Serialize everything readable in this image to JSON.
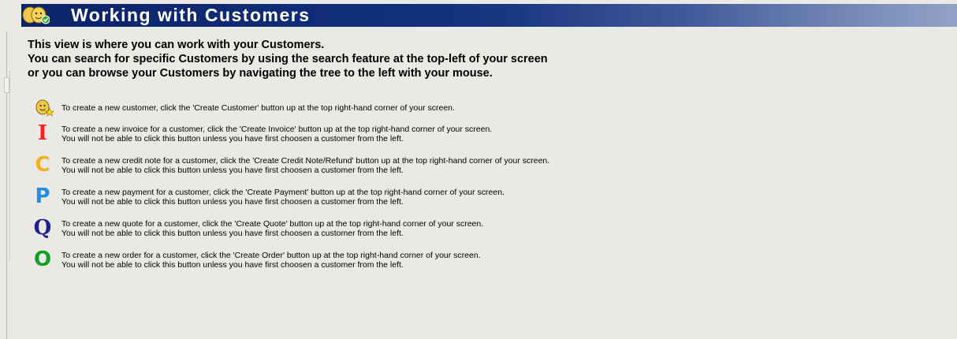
{
  "header": {
    "title": "Working with Customers",
    "icon": "customers-icon"
  },
  "intro": {
    "lines": [
      "This view is where you can work with your Customers.",
      "You can search for specific Customers by using the search feature at the top-left of your screen",
      "or you can browse your Customers by navigating the tree to the left with your mouse."
    ]
  },
  "tips": [
    {
      "icon": "create-customer-icon",
      "glyph": "",
      "color": "#000000",
      "line1": "To create a new customer, click the 'Create Customer' button up at the top right-hand corner of your screen.",
      "line2": ""
    },
    {
      "icon": "invoice-icon",
      "glyph": "I",
      "color": "#ff1e1e",
      "line1": "To create a new invoice for a customer, click the 'Create Invoice' button up at the top right-hand corner of your screen.",
      "line2": "You will not be able to click this button unless you have first choosen a customer from the left."
    },
    {
      "icon": "credit-note-icon",
      "glyph": "C",
      "color": "#f2b21a",
      "line1": "To create a new credit note for a customer, click the 'Create Credit Note/Refund' button up at the top right-hand corner of your screen.",
      "line2": "You will not be able to click this button unless you have first choosen a customer from the left."
    },
    {
      "icon": "payment-icon",
      "glyph": "P",
      "color": "#1e8ee6",
      "line1": "To create a new payment for a customer, click the 'Create Payment' button up at the top right-hand corner of your screen.",
      "line2": "You will not be able to click this button unless you have first choosen a customer from the left."
    },
    {
      "icon": "quote-icon",
      "glyph": "Q",
      "color": "#20208a",
      "line1": "To create a new quote for a customer, click the 'Create Quote' button up at the top right-hand corner of your screen.",
      "line2": "You will not be able to click this button unless you have first choosen a customer from the left."
    },
    {
      "icon": "order-icon",
      "glyph": "O",
      "color": "#12a024",
      "line1": "To create a new order for a customer, click the 'Create Order' button up at the top right-hand corner of your screen.",
      "line2": "You will not be able to click this button unless you have first choosen a customer from the left."
    }
  ]
}
